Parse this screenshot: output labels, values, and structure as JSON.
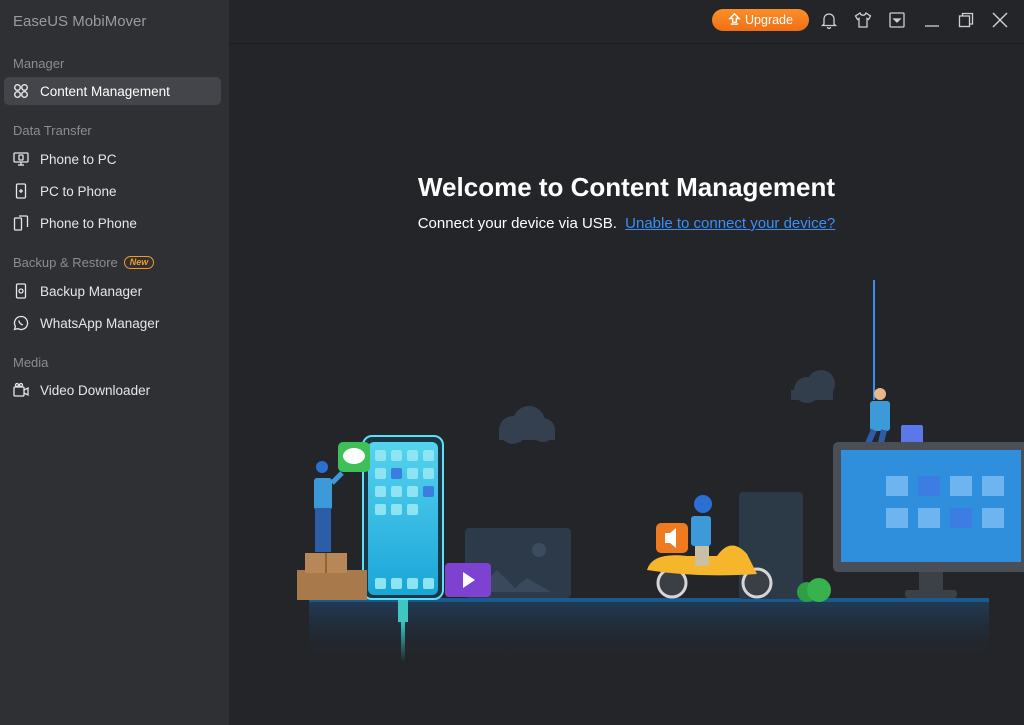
{
  "app": {
    "title": "EaseUS MobiMover"
  },
  "sidebar": {
    "sections": [
      {
        "label": "Manager"
      },
      {
        "label": "Data Transfer"
      },
      {
        "label": "Backup & Restore",
        "badge": "New"
      },
      {
        "label": "Media"
      }
    ],
    "items": [
      {
        "label": "Content Management",
        "icon": "content-management-icon",
        "active": true
      },
      {
        "label": "Phone to PC",
        "icon": "phone-to-pc-icon"
      },
      {
        "label": "PC to Phone",
        "icon": "pc-to-phone-icon"
      },
      {
        "label": "Phone to Phone",
        "icon": "phone-to-phone-icon"
      },
      {
        "label": "Backup Manager",
        "icon": "backup-manager-icon"
      },
      {
        "label": "WhatsApp Manager",
        "icon": "whatsapp-icon"
      },
      {
        "label": "Video Downloader",
        "icon": "video-downloader-icon"
      }
    ]
  },
  "topbar": {
    "upgrade_label": "Upgrade",
    "icons": [
      "bell-icon",
      "tshirt-icon",
      "menu-icon",
      "minimize-icon",
      "restore-icon",
      "close-icon"
    ]
  },
  "main": {
    "title": "Welcome to Content Management",
    "subtitle": "Connect your device via USB.",
    "link": "Unable to connect your device?"
  },
  "colors": {
    "accent": "#f07a1e",
    "link": "#3a8ff5",
    "sidebar_bg": "#2f3034",
    "main_bg": "#242529"
  }
}
